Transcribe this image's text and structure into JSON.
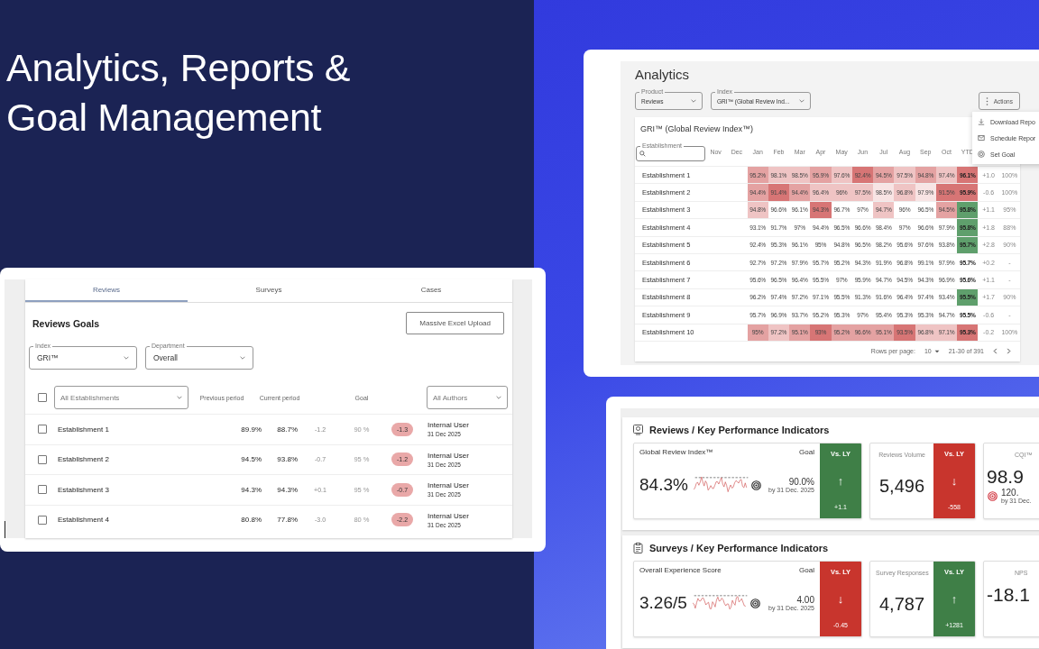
{
  "headline": "Analytics, Reports &\nGoal Management",
  "analytics": {
    "title": "Analytics",
    "filters": [
      {
        "label": "Product",
        "value": "Reviews"
      },
      {
        "label": "Index",
        "value": "GRI™ (Global Review Ind..."
      }
    ],
    "actions": "Actions",
    "menu": [
      {
        "kind": "download",
        "label": "Download Repo"
      },
      {
        "kind": "mail",
        "label": "Schedule Repor"
      },
      {
        "kind": "goal",
        "label": "Set Goal"
      }
    ],
    "table": {
      "title": "GRI™ (Global Review Index™)",
      "search_label": "Establishment",
      "columns": [
        "Nov",
        "Dec",
        "Jan",
        "Feb",
        "Mar",
        "Apr",
        "May",
        "Jun",
        "Jul",
        "Aug",
        "Sep",
        "Oct",
        "YTD"
      ],
      "rows": [
        {
          "name": "Establishment 1",
          "cells": [
            {},
            {},
            {
              "value": "95.2%",
              "color": "#e4a2a2"
            },
            {
              "value": "98.1%",
              "color": "#efc4c4"
            },
            {
              "value": "98.5%",
              "color": "#efc4c4"
            },
            {
              "value": "95.9%",
              "color": "#e4a2a2"
            },
            {
              "value": "97.6%",
              "color": "#efc4c4"
            },
            {
              "value": "92.4%",
              "color": "#d77575"
            },
            {
              "value": "94.5%",
              "color": "#e4a2a2"
            },
            {
              "value": "97.5%",
              "color": "#efc4c4"
            },
            {
              "value": "94.8%",
              "color": "#e4a2a2"
            },
            {
              "value": "97.4%",
              "color": "#efc4c4"
            },
            {
              "value": "96.1%",
              "color": "#d77575"
            }
          ],
          "change": "+1.0",
          "share": "100%"
        },
        {
          "name": "Establishment 2",
          "cells": [
            {},
            {},
            {
              "value": "94.4%",
              "color": "#e4a2a2"
            },
            {
              "value": "91.4%",
              "color": "#d77575"
            },
            {
              "value": "94.4%",
              "color": "#e4a2a2"
            },
            {
              "value": "96.4%",
              "color": "#efc4c4"
            },
            {
              "value": "96%",
              "color": "#efc4c4"
            },
            {
              "value": "97.5%",
              "color": "#efc4c4"
            },
            {
              "value": "98.5%",
              "color": "#f8e4e4"
            },
            {
              "value": "96.8%",
              "color": "#efc4c4"
            },
            {
              "value": "97.9%",
              "color": "#f8e4e4"
            },
            {
              "value": "91.5%",
              "color": "#d77575"
            },
            {
              "value": "95.9%",
              "color": "#d77575"
            }
          ],
          "change": "-0.6",
          "share": "100%"
        },
        {
          "name": "Establishment 3",
          "cells": [
            {},
            {},
            {
              "value": "94.8%",
              "color": "#efc4c4"
            },
            {
              "value": "96.6%"
            },
            {
              "value": "96.1%"
            },
            {
              "value": "94.3%",
              "color": "#d77575"
            },
            {
              "value": "96.7%"
            },
            {
              "value": "97%"
            },
            {
              "value": "94.7%",
              "color": "#efc4c4"
            },
            {
              "value": "96%"
            },
            {
              "value": "96.5%"
            },
            {
              "value": "94.5%",
              "color": "#e4a2a2"
            },
            {
              "value": "95.8%",
              "color": "#5f9f6c"
            }
          ],
          "change": "+1.1",
          "share": "95%"
        },
        {
          "name": "Establishment 4",
          "cells": [
            {},
            {},
            {
              "value": "93.1%"
            },
            {
              "value": "91.7%"
            },
            {
              "value": "97%"
            },
            {
              "value": "94.4%"
            },
            {
              "value": "96.5%"
            },
            {
              "value": "96.6%"
            },
            {
              "value": "98.4%"
            },
            {
              "value": "97%"
            },
            {
              "value": "96.6%"
            },
            {
              "value": "97.9%"
            },
            {
              "value": "95.8%",
              "color": "#5f9f6c"
            }
          ],
          "change": "+1.8",
          "share": "88%"
        },
        {
          "name": "Establishment 5",
          "cells": [
            {},
            {},
            {
              "value": "92.4%"
            },
            {
              "value": "95.3%"
            },
            {
              "value": "96.1%"
            },
            {
              "value": "95%"
            },
            {
              "value": "94.8%"
            },
            {
              "value": "96.5%"
            },
            {
              "value": "98.2%"
            },
            {
              "value": "95.6%"
            },
            {
              "value": "97.6%"
            },
            {
              "value": "93.8%"
            },
            {
              "value": "95.7%",
              "color": "#5f9f6c"
            }
          ],
          "change": "+2.8",
          "share": "90%"
        },
        {
          "name": "Establishment 6",
          "cells": [
            {},
            {},
            {
              "value": "92.7%"
            },
            {
              "value": "97.2%"
            },
            {
              "value": "97.9%"
            },
            {
              "value": "95.7%"
            },
            {
              "value": "95.2%"
            },
            {
              "value": "94.3%"
            },
            {
              "value": "91.9%"
            },
            {
              "value": "96.8%"
            },
            {
              "value": "99.1%"
            },
            {
              "value": "97.9%"
            },
            {
              "value": "95.7%"
            }
          ],
          "change": "+0.2",
          "share": "-"
        },
        {
          "name": "Establishment 7",
          "cells": [
            {},
            {},
            {
              "value": "95.6%"
            },
            {
              "value": "96.5%"
            },
            {
              "value": "96.4%"
            },
            {
              "value": "95.5%"
            },
            {
              "value": "97%"
            },
            {
              "value": "95.9%"
            },
            {
              "value": "94.7%"
            },
            {
              "value": "94.5%"
            },
            {
              "value": "94.3%"
            },
            {
              "value": "96.9%"
            },
            {
              "value": "95.6%"
            }
          ],
          "change": "+1.1",
          "share": "-"
        },
        {
          "name": "Establishment 8",
          "cells": [
            {},
            {},
            {
              "value": "96.2%"
            },
            {
              "value": "97.4%"
            },
            {
              "value": "97.2%"
            },
            {
              "value": "97.1%"
            },
            {
              "value": "95.5%"
            },
            {
              "value": "91.3%"
            },
            {
              "value": "91.6%"
            },
            {
              "value": "96.4%"
            },
            {
              "value": "97.4%"
            },
            {
              "value": "93.4%"
            },
            {
              "value": "95.5%",
              "color": "#5f9f6c"
            }
          ],
          "change": "+1.7",
          "share": "90%"
        },
        {
          "name": "Establishment 9",
          "cells": [
            {},
            {},
            {
              "value": "95.7%"
            },
            {
              "value": "96.9%"
            },
            {
              "value": "93.7%"
            },
            {
              "value": "95.2%"
            },
            {
              "value": "95.3%"
            },
            {
              "value": "97%"
            },
            {
              "value": "95.4%"
            },
            {
              "value": "95.3%"
            },
            {
              "value": "95.3%"
            },
            {
              "value": "94.7%"
            },
            {
              "value": "95.5%"
            }
          ],
          "change": "-0.6",
          "share": "-"
        },
        {
          "name": "Establishment 10",
          "cells": [
            {},
            {},
            {
              "value": "95%",
              "color": "#e4a2a2"
            },
            {
              "value": "97.2%",
              "color": "#efc4c4"
            },
            {
              "value": "95.1%",
              "color": "#e4a2a2"
            },
            {
              "value": "93%",
              "color": "#d77575"
            },
            {
              "value": "95.2%",
              "color": "#e4a2a2"
            },
            {
              "value": "96.6%",
              "color": "#e4a2a2"
            },
            {
              "value": "95.1%",
              "color": "#e4a2a2"
            },
            {
              "value": "93.5%",
              "color": "#d77575"
            },
            {
              "value": "96.8%",
              "color": "#efc4c4"
            },
            {
              "value": "97.1%",
              "color": "#efc4c4"
            },
            {
              "value": "95.3%",
              "color": "#d77575"
            }
          ],
          "change": "-0.2",
          "share": "100%"
        }
      ],
      "rows_per_page_label": "Rows per page:",
      "rows_per_page": "10",
      "range": "21-30 of 391"
    }
  },
  "goals": {
    "tabs": [
      {
        "label": "Reviews",
        "selected": true
      },
      {
        "label": "Surveys",
        "selected": false
      },
      {
        "label": "Cases",
        "selected": false
      }
    ],
    "title": "Reviews Goals",
    "upload_button": "Massive Excel Upload",
    "filters": [
      {
        "label": "Index",
        "value": "GRI™"
      },
      {
        "label": "Department",
        "value": "Overall"
      }
    ],
    "header": {
      "checked": false,
      "establishments": "All Establishments",
      "previous": "Previous period",
      "current": "Current period",
      "goal": "Goal",
      "authors": "All Authors"
    },
    "rows": [
      {
        "checked": false,
        "name": "Establishment 1",
        "previous": "89.9%",
        "current": "88.7%",
        "delta": "-1.2",
        "goal": "90 %",
        "gap": "-1.3",
        "author": "Internal User",
        "date": "31 Dec 2025"
      },
      {
        "checked": false,
        "name": "Establishment 2",
        "previous": "94.5%",
        "current": "93.8%",
        "delta": "-0.7",
        "goal": "95 %",
        "gap": "-1.2",
        "author": "Internal User",
        "date": "31 Dec 2025"
      },
      {
        "checked": false,
        "name": "Establishment 3",
        "previous": "94.3%",
        "current": "94.3%",
        "delta": "+0.1",
        "goal": "95 %",
        "gap": "-0.7",
        "author": "Internal User",
        "date": "31 Dec 2025"
      },
      {
        "checked": false,
        "name": "Establishment 4",
        "previous": "80.8%",
        "current": "77.8%",
        "delta": "-3.0",
        "goal": "80 %",
        "gap": "-2.2",
        "author": "Internal User",
        "date": "31 Dec 2025"
      }
    ]
  },
  "kpis": {
    "sections": [
      {
        "kind": "reviews",
        "title": "**Reviews /** Key Performance Indicators",
        "cards": [
          {
            "kind": "goal",
            "label": "Global Review Index™",
            "goal_label": "Goal",
            "value": "84.3%",
            "goal": "90.0%",
            "date": "by 31 Dec. 2025",
            "vs": {
              "label": "Vs. LY",
              "color": "#3f7f47",
              "arrow": "↑",
              "delta": "+1.1"
            }
          },
          {
            "kind": "count",
            "label": "Reviews Volume",
            "value": "5,496",
            "vs": {
              "label": "Vs. LY",
              "color": "#c8352d",
              "arrow": "↓",
              "delta": "-558"
            }
          },
          {
            "kind": "partial",
            "label": "CQI™",
            "value": "98.9",
            "goal": "120.",
            "date": "by 31 Dec."
          }
        ]
      },
      {
        "kind": "surveys",
        "title": "**Surveys /** Key Performance Indicators",
        "cards": [
          {
            "kind": "goal",
            "label": "Overall Experience Score",
            "goal_label": "Goal",
            "value": "3.26/5",
            "goal": "4.00",
            "date": "by 31 Dec. 2025",
            "vs": {
              "label": "Vs. LY",
              "color": "#c8352d",
              "arrow": "↓",
              "delta": "-0.45"
            }
          },
          {
            "kind": "count",
            "label": "Survey Responses",
            "value": "4,787",
            "vs": {
              "label": "Vs. LY",
              "color": "#3f7f47",
              "arrow": "↑",
              "delta": "+1281"
            }
          },
          {
            "kind": "partial",
            "label": "NPS",
            "value": "-18.1"
          }
        ]
      }
    ]
  }
}
